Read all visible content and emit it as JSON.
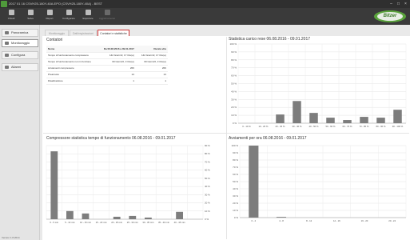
{
  "window": {
    "title": "2017 01 16 CSVH25-180Y-40A.EPO (CSVH25-180Y-40A) - BEST"
  },
  "toolbar": {
    "buttons": [
      {
        "label": "Chiudi",
        "icon": "folder-icon"
      },
      {
        "label": "Salva",
        "icon": "save-icon"
      },
      {
        "label": "Report",
        "icon": "report-icon"
      },
      {
        "label": "Configurare",
        "icon": "gear-icon"
      },
      {
        "label": "Esportare",
        "icon": "export-icon"
      },
      {
        "label": "Aggiornamento",
        "icon": "refresh-icon"
      }
    ],
    "brand": "Bitzer"
  },
  "sidebar": {
    "items": [
      {
        "label": "Panoramica",
        "icon": "overview-icon"
      },
      {
        "label": "Monitoraggio",
        "icon": "monitor-icon"
      },
      {
        "label": "Configura",
        "icon": "config-icon"
      },
      {
        "label": "Allarmi",
        "icon": "alarm-icon"
      }
    ],
    "version": "Version 1.8.2014"
  },
  "tabs": [
    {
      "label": "Monitoraggio"
    },
    {
      "label": "Dati/registrazioni"
    },
    {
      "label": "Contatori e statistiche"
    }
  ],
  "counters": {
    "title": "Contatori",
    "headers": [
      "Nome",
      "Da 06.08.2016 a 09.01.2017",
      "Durata vita"
    ],
    "rows": [
      [
        "Tempo di funzionamento compressore",
        "142 Giorni/2, 17 Ore(e)",
        "142 Giorni/2, 17 Ore(e)"
      ],
      [
        "Tempo di funzionamento non in funzione",
        "60 Giorni/2, 3 Ore(e)",
        "60 Giorni/2, 3 Ore(e)"
      ],
      [
        "Avviamenti compressore",
        "266",
        "266"
      ],
      [
        "Prearresto",
        "13",
        "13"
      ],
      [
        "Disattivazione",
        "1",
        "1"
      ]
    ]
  },
  "chart_data": [
    {
      "type": "bar",
      "title": "Statistica carico rese 06.08.2016 - 09.01.2017",
      "categories": [
        "0 - 10 %",
        "10 - 20 %",
        "20 - 30 %",
        "30 - 40 %",
        "40 - 50 %",
        "50 - 60 %",
        "60 - 70 %",
        "70 - 80 %",
        "80 - 90 %",
        "90 - 100 %"
      ],
      "values": [
        0,
        0,
        11,
        28,
        13,
        7,
        4,
        8,
        7,
        17
      ],
      "ylim": [
        0,
        100
      ],
      "yticks": [
        "100 %",
        "90 %",
        "80 %",
        "70 %",
        "60 %",
        "50 %",
        "40 %",
        "30 %",
        "20 %",
        "10 %",
        "0 %"
      ],
      "grid": true
    },
    {
      "type": "bar",
      "title": "Compressore statistica tempo di funzionamento 06.08.2016 - 09.01.2017",
      "categories": [
        "0 - 5 min",
        "5 - 10 min",
        "10 - 15 min",
        "15 - 20 min",
        "20 - 25 min",
        "25 - 30 min",
        "30 - 35 min",
        "35 - 40 min",
        "40 - 45 min",
        ""
      ],
      "values": [
        83,
        10,
        7,
        0,
        3,
        4,
        2,
        0,
        9
      ],
      "ylim": [
        0,
        90
      ],
      "yticks": [
        "90 %",
        "80 %",
        "70 %",
        "60 %",
        "50 %",
        "40 %",
        "30 %",
        "20 %",
        "10 %",
        "0 %"
      ],
      "grid": true
    },
    {
      "type": "bar",
      "title": "Avviamenti per ora 06.08.2016 - 09.01.2017",
      "categories": [
        "0 - 4",
        "4 - 8",
        "8 - 12",
        "12 - 16",
        "16 - 20",
        "20 - 24"
      ],
      "values": [
        100,
        1,
        0,
        0,
        0,
        0
      ],
      "ylim": [
        0,
        100
      ],
      "yticks": [
        "100 %",
        "90 %",
        "80 %",
        "70 %",
        "60 %",
        "50 %",
        "40 %",
        "30 %",
        "20 %",
        "10 %",
        "0 %"
      ],
      "grid": true
    }
  ]
}
